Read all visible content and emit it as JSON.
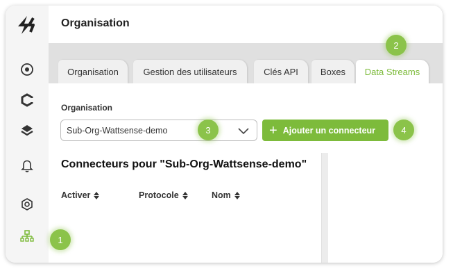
{
  "header": {
    "title": "Organisation"
  },
  "tabs": [
    {
      "label": "Organisation"
    },
    {
      "label": "Gestion des utilisateurs"
    },
    {
      "label": "Clés API"
    },
    {
      "label": "Boxes"
    },
    {
      "label": "Data Streams",
      "active": true
    }
  ],
  "form": {
    "org_label": "Organisation",
    "org_select_value": "Sub-Org-Wattsense-demo",
    "add_button_label": "Ajouter un connecteur"
  },
  "connectors": {
    "title": "Connecteurs pour \"Sub-Org-Wattsense-demo\"",
    "columns": [
      "Activer",
      "Protocole",
      "Nom"
    ]
  },
  "badges": [
    "1",
    "2",
    "3",
    "4"
  ],
  "sidebar": {
    "icons": [
      "location-icon",
      "connectors-icon",
      "layers-icon",
      "bell-icon",
      "devices-icon",
      "organisation-icon"
    ]
  },
  "colors": {
    "accent": "#7dbb3b",
    "badge": "#8bc34a"
  }
}
